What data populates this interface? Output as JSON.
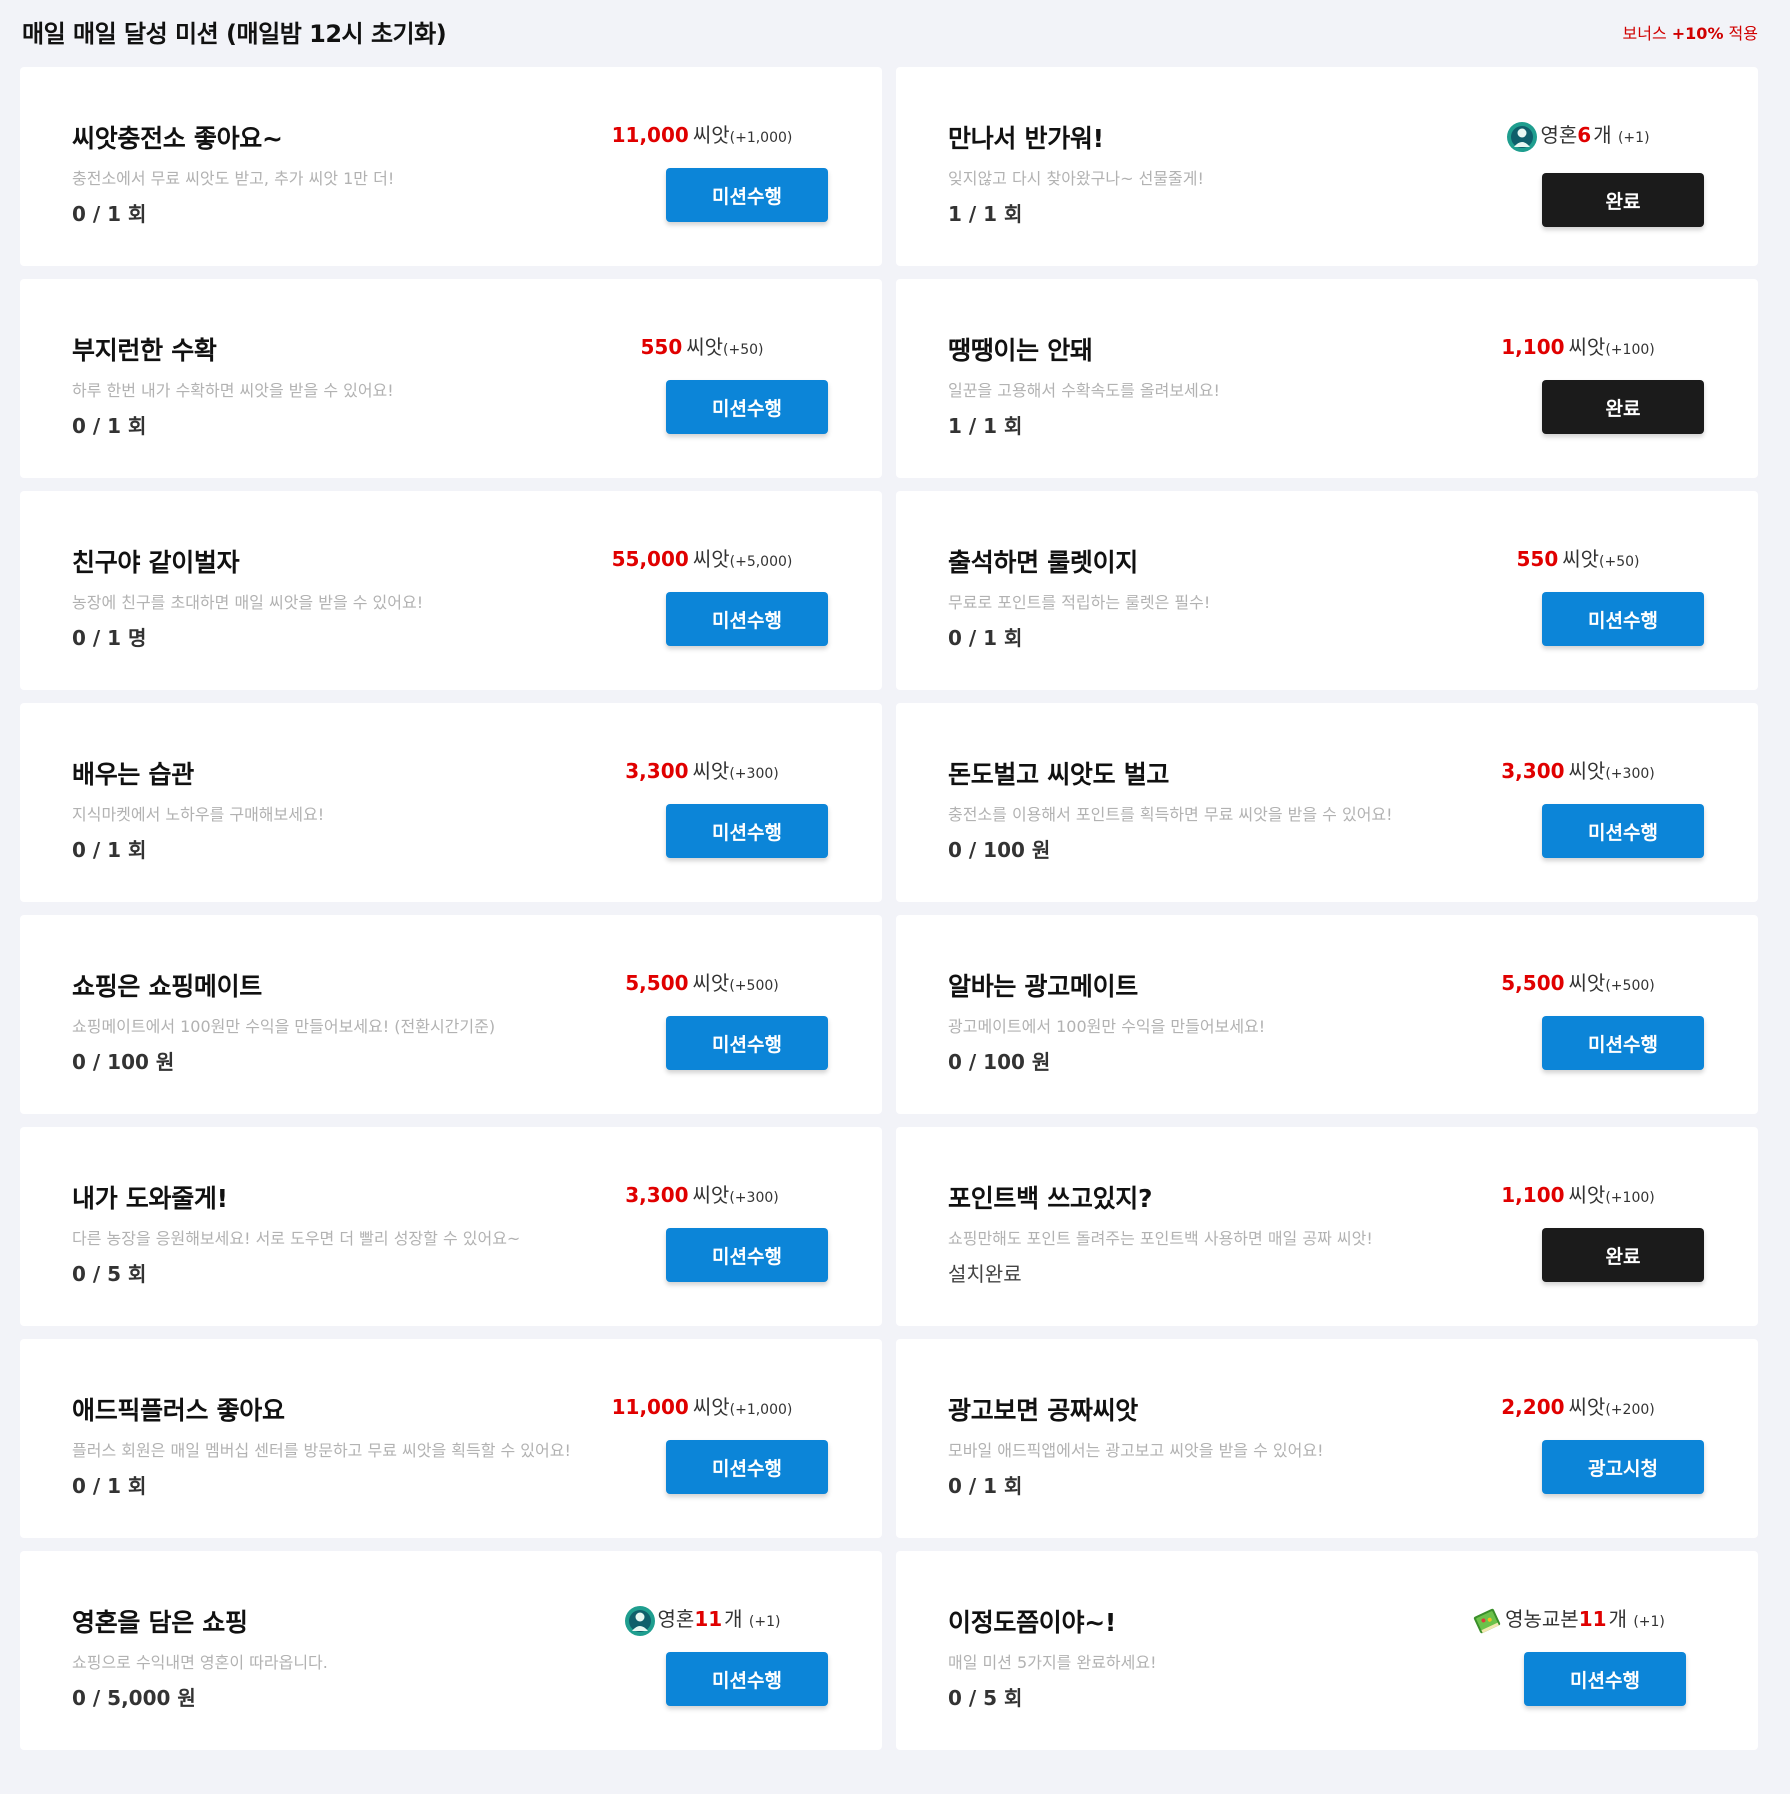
{
  "header": {
    "title": "매일 매일 달성 미션 (매일밤 12시 초기화)",
    "bonus_prefix": "보너스 ",
    "bonus_value": "+10%",
    "bonus_suffix": " 적용"
  },
  "colors": {
    "accent_blue": "#0c85d8",
    "done_black": "#1b1b1b",
    "reward_red": "#e00000"
  },
  "missions": [
    {
      "title": "씨앗충전소 좋아요~",
      "desc": "충전소에서 무료 씨앗도 받고, 추가 씨앗 1만 더!",
      "progress": "0 / 1 회",
      "reward_amount": "11,000",
      "reward_unit": "씨앗",
      "reward_bonus": "(+1,000)",
      "button": "미션수행"
    },
    {
      "title": "만나서 반가워!",
      "desc": "잊지않고 다시 찾아왔구나~ 선물줄게!",
      "progress": "1 / 1 회",
      "reward_icon": "soul-icon",
      "reward_prefix": "영혼",
      "reward_amount": "6",
      "reward_unit": "개",
      "reward_bonus": "(+1)",
      "button": "완료"
    },
    {
      "title": "부지런한 수확",
      "desc": "하루 한번 내가 수확하면 씨앗을 받을 수 있어요!",
      "progress": "0 / 1 회",
      "reward_amount": "550",
      "reward_unit": "씨앗",
      "reward_bonus": "(+50)",
      "button": "미션수행"
    },
    {
      "title": "땡땡이는 안돼",
      "desc": "일꾼을 고용해서 수확속도를 올려보세요!",
      "progress": "1 / 1 회",
      "reward_amount": "1,100",
      "reward_unit": "씨앗",
      "reward_bonus": "(+100)",
      "button": "완료"
    },
    {
      "title": "친구야 같이벌자",
      "desc": "농장에 친구를 초대하면 매일 씨앗을 받을 수 있어요!",
      "progress": "0 / 1 명",
      "reward_amount": "55,000",
      "reward_unit": "씨앗",
      "reward_bonus": "(+5,000)",
      "button": "미션수행"
    },
    {
      "title": "출석하면 룰렛이지",
      "desc": "무료로 포인트를 적립하는 룰렛은 필수!",
      "progress": "0 / 1 회",
      "reward_amount": "550",
      "reward_unit": "씨앗",
      "reward_bonus": "(+50)",
      "button": "미션수행"
    },
    {
      "title": "배우는 습관",
      "desc": "지식마켓에서 노하우를 구매해보세요!",
      "progress": "0 / 1 회",
      "reward_amount": "3,300",
      "reward_unit": "씨앗",
      "reward_bonus": "(+300)",
      "button": "미션수행"
    },
    {
      "title": "돈도벌고 씨앗도 벌고",
      "desc": "충전소를 이용해서 포인트를 획득하면 무료 씨앗을 받을 수 있어요!",
      "progress": "0 / 100 원",
      "reward_amount": "3,300",
      "reward_unit": "씨앗",
      "reward_bonus": "(+300)",
      "button": "미션수행"
    },
    {
      "title": "쇼핑은 쇼핑메이트",
      "desc": "쇼핑메이트에서 100원만 수익을 만들어보세요! (전환시간기준)",
      "progress": "0 / 100 원",
      "reward_amount": "5,500",
      "reward_unit": "씨앗",
      "reward_bonus": "(+500)",
      "button": "미션수행"
    },
    {
      "title": "알바는 광고메이트",
      "desc": "광고메이트에서 100원만 수익을 만들어보세요!",
      "progress": "0 / 100 원",
      "reward_amount": "5,500",
      "reward_unit": "씨앗",
      "reward_bonus": "(+500)",
      "button": "미션수행"
    },
    {
      "title": "내가 도와줄게!",
      "desc": "다른 농장을 응원해보세요! 서로 도우면 더 빨리 성장할 수 있어요~",
      "progress": "0 / 5 회",
      "reward_amount": "3,300",
      "reward_unit": "씨앗",
      "reward_bonus": "(+300)",
      "button": "미션수행"
    },
    {
      "title": "포인트백 쓰고있지?",
      "desc": "쇼핑만해도 포인트 돌려주는 포인트백 사용하면 매일 공짜 씨앗!",
      "progress": "설치완료",
      "reward_amount": "1,100",
      "reward_unit": "씨앗",
      "reward_bonus": "(+100)",
      "button": "완료"
    },
    {
      "title": "애드픽플러스 좋아요",
      "desc": "플러스 회원은 매일 멤버십 센터를 방문하고 무료 씨앗을 획득할 수 있어요!",
      "progress": "0 / 1 회",
      "reward_amount": "11,000",
      "reward_unit": "씨앗",
      "reward_bonus": "(+1,000)",
      "button": "미션수행"
    },
    {
      "title": "광고보면 공짜씨앗",
      "desc": "모바일 애드픽앱에서는 광고보고 씨앗을 받을 수 있어요!",
      "progress": "0 / 1 회",
      "reward_amount": "2,200",
      "reward_unit": "씨앗",
      "reward_bonus": "(+200)",
      "button": "광고시청"
    },
    {
      "title": "영혼을 담은 쇼핑",
      "desc": "쇼핑으로 수익내면 영혼이 따라옵니다.",
      "progress": "0 / 5,000 원",
      "reward_icon": "soul-icon",
      "reward_prefix": "영혼",
      "reward_amount": "11",
      "reward_unit": "개",
      "reward_bonus": "(+1)",
      "button": "미션수행"
    },
    {
      "title": "이정도쯤이야~!",
      "desc": "매일 미션 5가지를 완료하세요!",
      "progress": "0 / 5 회",
      "reward_icon": "book-icon",
      "reward_prefix": "영농교본",
      "reward_amount": "11",
      "reward_unit": "개",
      "reward_bonus": "(+1)",
      "button": "미션수행"
    }
  ]
}
